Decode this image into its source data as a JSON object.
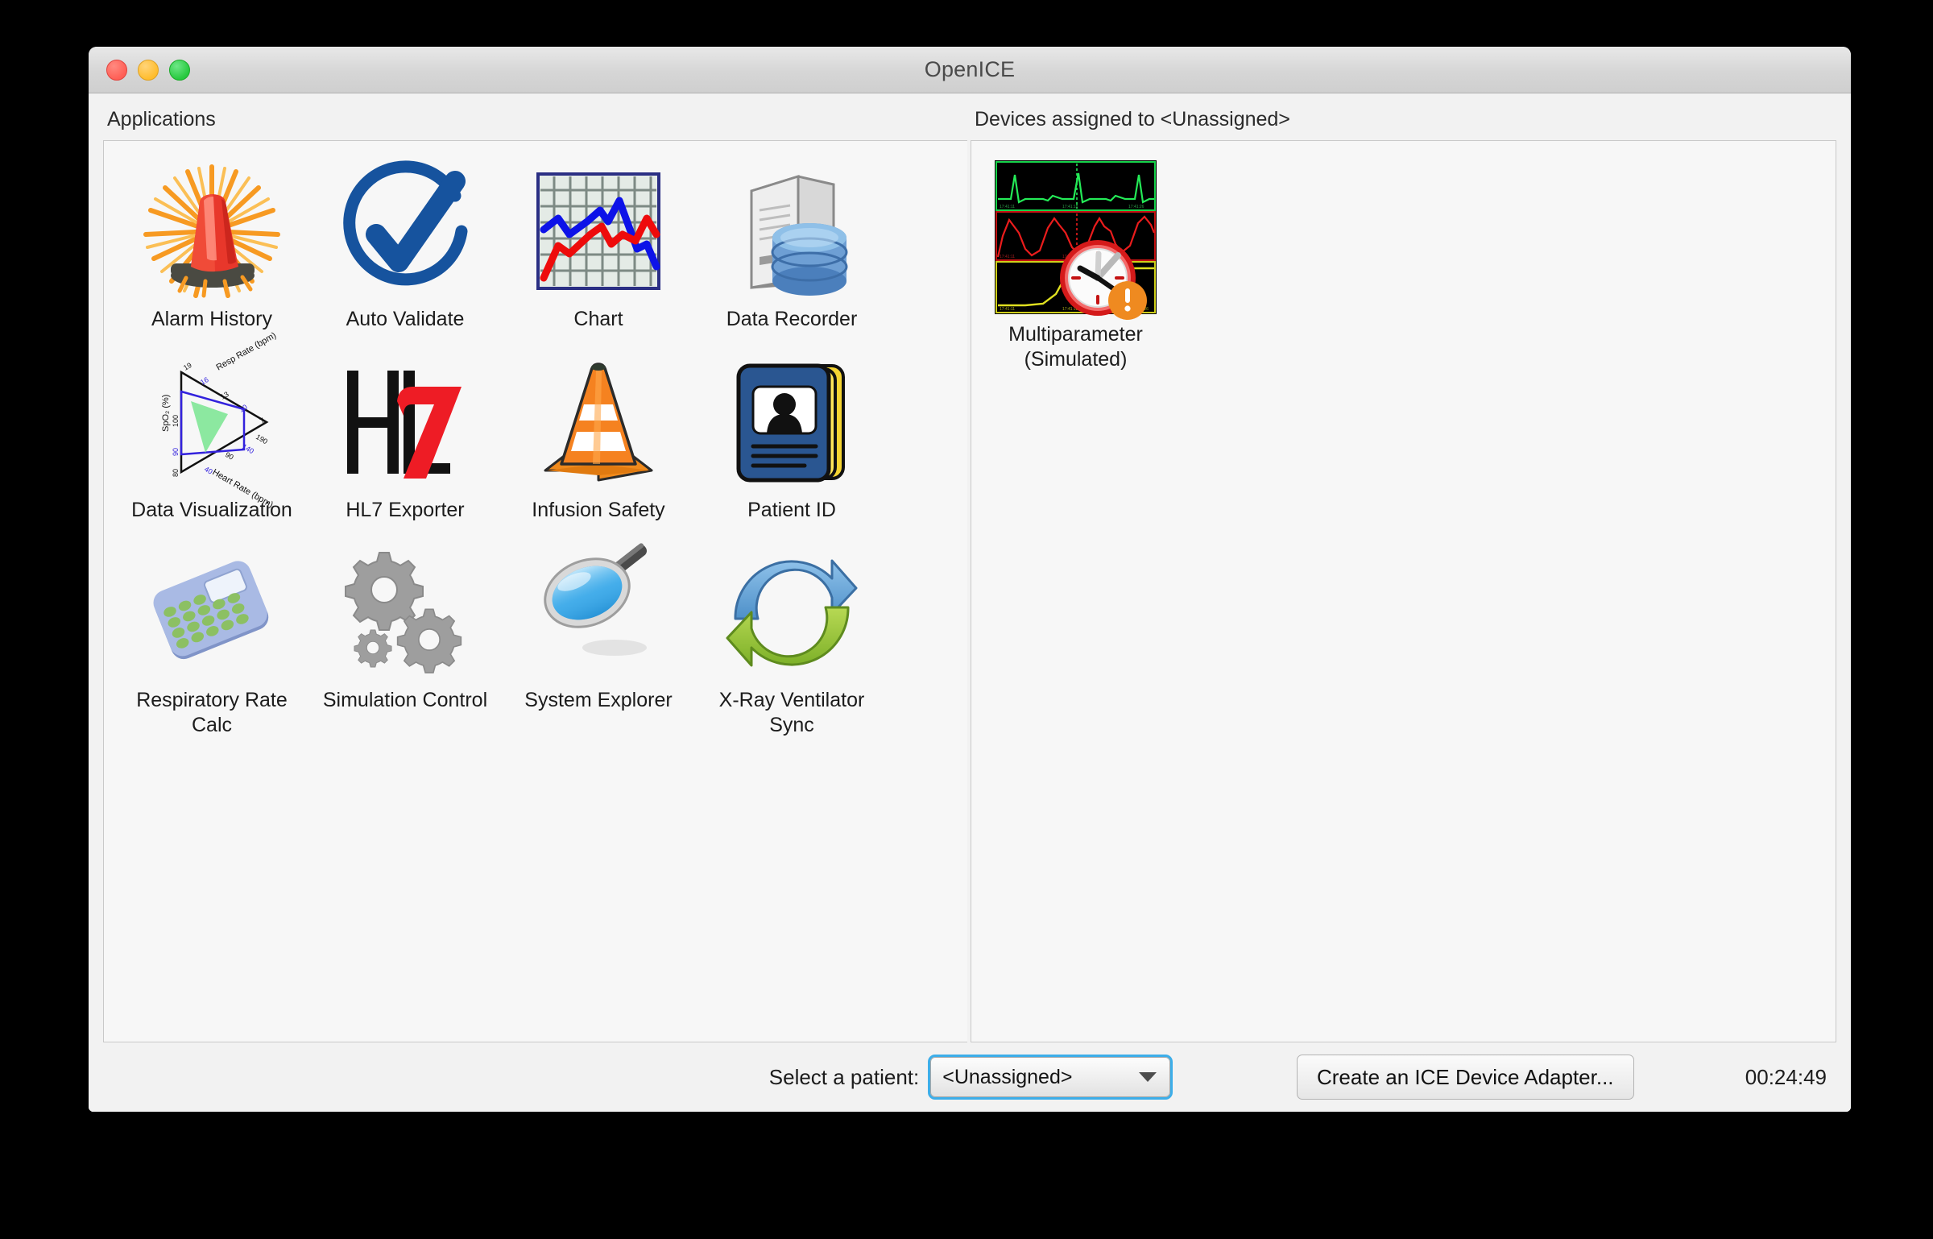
{
  "window": {
    "title": "OpenICE",
    "traffic_lights": [
      "close",
      "minimize",
      "maximize"
    ]
  },
  "applications_panel": {
    "heading": "Applications",
    "items": [
      {
        "label": "Alarm History",
        "icon": "alarm-siren-icon"
      },
      {
        "label": "Auto Validate",
        "icon": "check-circle-icon"
      },
      {
        "label": "Chart",
        "icon": "line-chart-icon"
      },
      {
        "label": "Data Recorder",
        "icon": "server-database-icon"
      },
      {
        "label": "Data Visualization",
        "icon": "ternary-plot-icon"
      },
      {
        "label": "HL7 Exporter",
        "icon": "hl7-logo-icon"
      },
      {
        "label": "Infusion Safety",
        "icon": "traffic-cone-icon"
      },
      {
        "label": "Patient ID",
        "icon": "id-badge-icon"
      },
      {
        "label": "Respiratory Rate Calc",
        "icon": "calculator-icon"
      },
      {
        "label": "Simulation Control",
        "icon": "gears-icon"
      },
      {
        "label": "System Explorer",
        "icon": "magnifier-icon"
      },
      {
        "label": "X-Ray Ventilator Sync",
        "icon": "sync-arrows-icon"
      }
    ]
  },
  "devices_panel": {
    "heading": "Devices assigned to <Unassigned>",
    "items": [
      {
        "label": "Multiparameter (Simulated)",
        "icon": "multiparameter-monitor-icon",
        "badge": "warning"
      }
    ]
  },
  "bottom_bar": {
    "patient_label": "Select a patient:",
    "patient_selected": "<Unassigned>",
    "patient_options": [
      "<Unassigned>"
    ],
    "adapter_button": "Create an ICE Device Adapter...",
    "clock": "00:24:49"
  },
  "colors": {
    "focus_ring": "#3daee9",
    "window_bg": "#f2f2f2",
    "panel_bg": "#f7f7f7",
    "panel_border": "#c9c9c9",
    "text": "#1c1c1c",
    "hl7_red": "#ee1c25",
    "validate_blue": "#16539e"
  }
}
